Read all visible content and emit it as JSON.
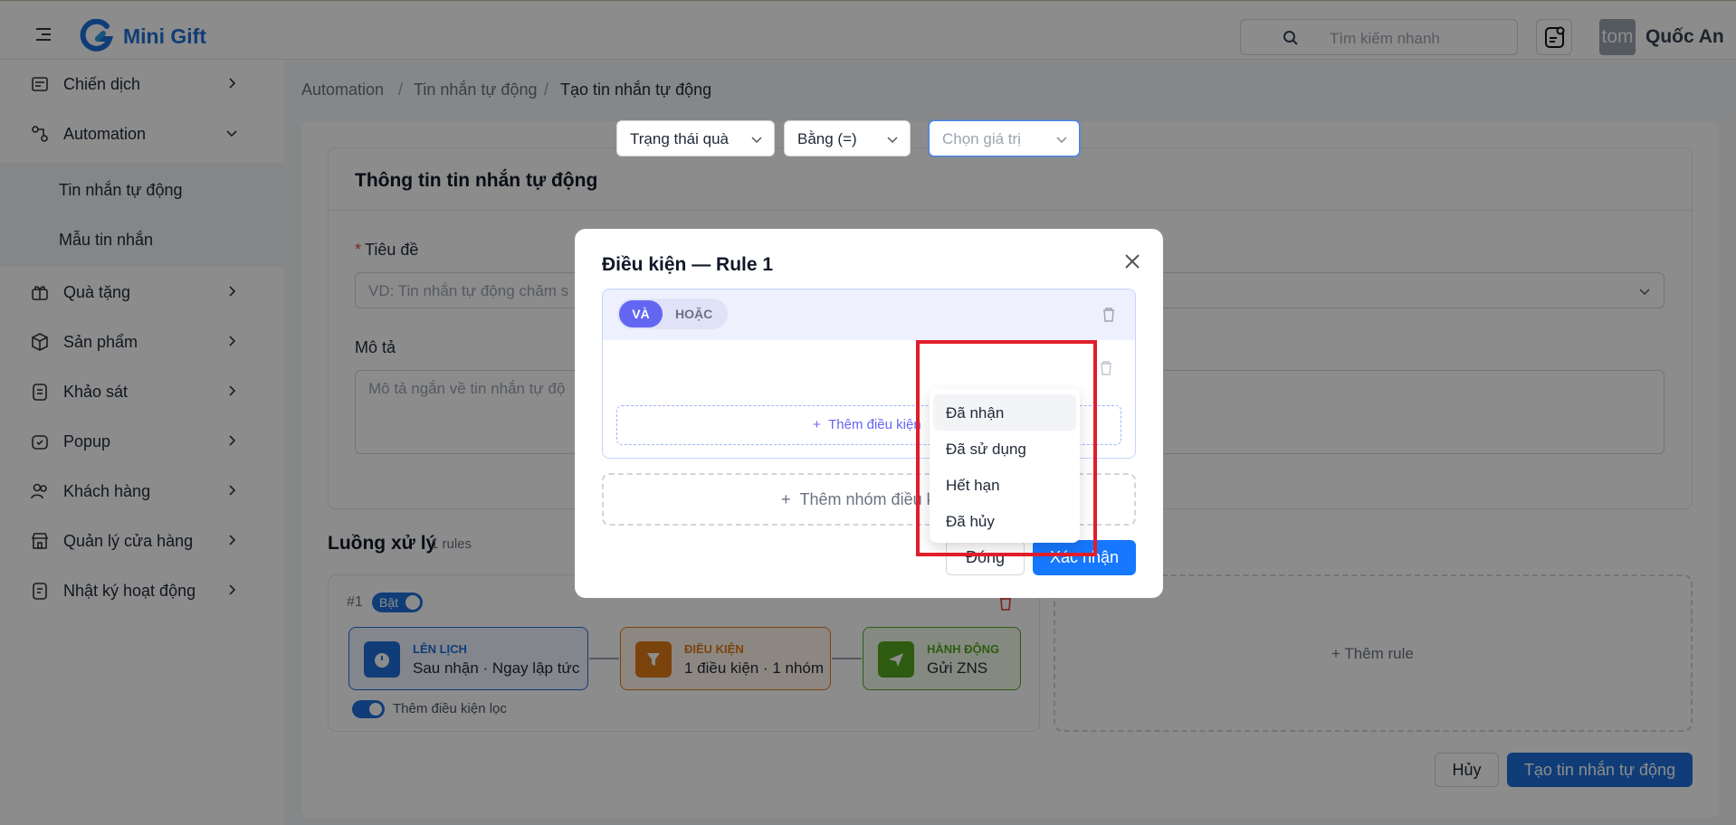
{
  "header": {
    "brand": "Mini Gift",
    "search_placeholder": "Tìm kiếm nhanh",
    "avatar_text": "tom",
    "username": "Quốc An"
  },
  "sidebar": {
    "items": [
      {
        "label": "Chiến dịch",
        "icon": "campaign-icon"
      },
      {
        "label": "Automation",
        "icon": "automation-icon",
        "expanded": true
      },
      {
        "label": "Quà tặng",
        "icon": "gift-icon"
      },
      {
        "label": "Sản phẩm",
        "icon": "product-box-icon"
      },
      {
        "label": "Khảo sát",
        "icon": "survey-icon"
      },
      {
        "label": "Popup",
        "icon": "popup-icon"
      },
      {
        "label": "Khách hàng",
        "icon": "customers-icon"
      },
      {
        "label": "Quản lý cửa hàng",
        "icon": "store-icon"
      },
      {
        "label": "Nhật ký hoạt động",
        "icon": "activity-log-icon"
      }
    ],
    "submenu": [
      "Tin nhắn tự động",
      "Mẫu tin nhắn"
    ]
  },
  "breadcrumb": [
    "Automation",
    "Tin nhắn tự động",
    "Tạo tin nhắn tự động"
  ],
  "info_card": {
    "title": "Thông tin tin nhắn tự động",
    "title_label": "Tiêu đề",
    "title_placeholder": "VD: Tin nhắn tự động chăm s",
    "desc_label": "Mô tả",
    "desc_placeholder": "Mô tả ngắn về tin nhắn tự độ"
  },
  "flow": {
    "title": "Luồng xử lý",
    "count": "1 rules",
    "rule_number": "#1",
    "rule_toggle": "Bật",
    "steps": [
      {
        "caption": "LÊN LỊCH",
        "text": "Sau nhận · Ngay lập tức",
        "color": "#1e6fd9"
      },
      {
        "caption": "ĐIỀU KIỆN",
        "text": "1 điều kiện · 1 nhóm",
        "color": "#e07b16"
      },
      {
        "caption": "HÀNH ĐỘNG",
        "text": "Gửi ZNS",
        "color": "#52a81f"
      }
    ],
    "filter_label": "Thêm điều kiện lọc",
    "add_rule": "Thêm rule"
  },
  "footer": {
    "cancel": "Hủy",
    "create": "Tạo tin nhắn tự động"
  },
  "modal": {
    "title": "Điều kiện — Rule 1",
    "and_label": "VÀ",
    "or_label": "HOẶC",
    "field_value": "Trạng thái quà",
    "operator_value": "Bằng (=)",
    "value_placeholder": "Chọn giá trị",
    "add_condition": "Thêm điều kiện",
    "add_group": "Thêm nhóm điều kiện",
    "close_label": "Đóng",
    "confirm_label": "Xác nhận",
    "options": [
      "Đã nhận",
      "Đã sử dụng",
      "Hết hạn",
      "Đã hủy"
    ]
  },
  "colors": {
    "primary": "#1e6fd9",
    "accent": "#6366f1",
    "highlight": "#e11d2a"
  }
}
